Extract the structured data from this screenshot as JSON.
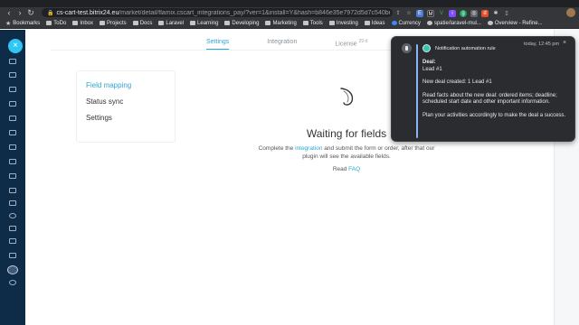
{
  "browser": {
    "url_host": "cs-cart-test.bitrix24.eu",
    "url_path": "/market/detail/flamix.cscart_integrations_pay/?ver=1&install=Y&hash=b846e35e7972d5d7c540be224341c...",
    "bookmarks": [
      "Bookmarks",
      "ToDo",
      "Inbox",
      "Projects",
      "Docs",
      "Laravel",
      "Learning",
      "Developing",
      "Marketing",
      "Tools",
      "Investing",
      "Ideas",
      "Currency",
      "spatie/laravel-mul...",
      "Overview - Refine..."
    ]
  },
  "tabs": [
    {
      "label": "Settings",
      "active": true
    },
    {
      "label": "Integration",
      "active": false
    },
    {
      "label": "License",
      "badge": "29 d",
      "active": false
    }
  ],
  "side_menu": [
    {
      "label": "Field mapping",
      "active": true
    },
    {
      "label": "Status sync",
      "active": false
    },
    {
      "label": "Settings",
      "active": false
    }
  ],
  "main": {
    "title": "Waiting for fields",
    "text_before_link": "Complete the ",
    "link": "integration",
    "text_after_link": " and submit the form or order, after that our plugin will see the available fields.",
    "read_prefix": "Read ",
    "read_link": "FAQ"
  },
  "notification": {
    "app_title": "Notification automation rule",
    "time": "today, 12:45 pm",
    "deal_label": "Deal:",
    "deal_name": "Lead #1",
    "line1": "New deal created: 1 Lead #1",
    "line2": "Read facts about the new deal: ordered items; deadline; scheduled start date and other important information.",
    "line3": "Plan your activities accordingly to make the deal a success."
  },
  "colors": {
    "accent": "#2fa6d6",
    "rail": "#0e2b47",
    "close_button": "#2fc6f6",
    "notification_bg": "#2b2c2f"
  }
}
